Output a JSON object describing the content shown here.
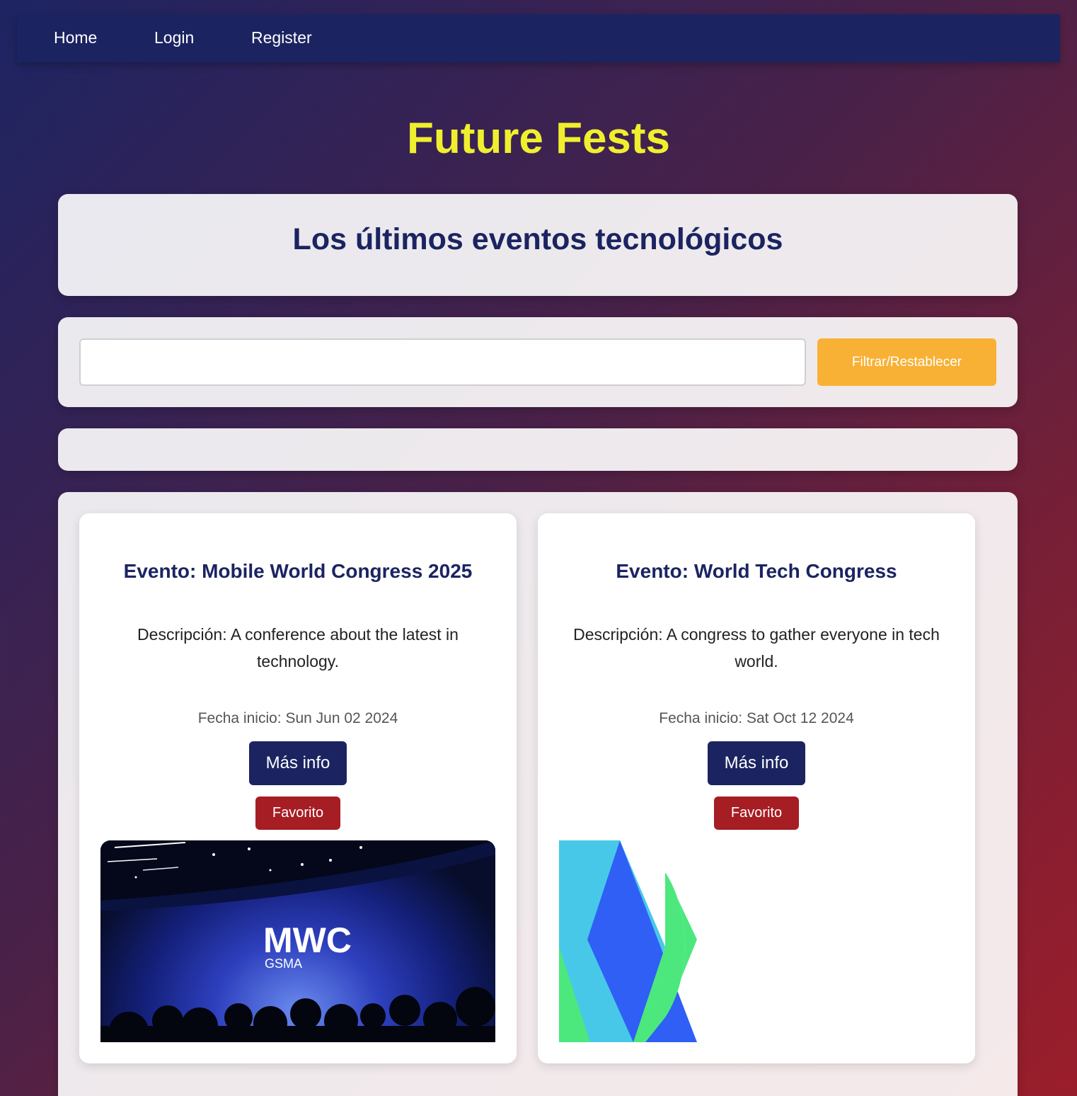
{
  "nav": {
    "home": "Home",
    "login": "Login",
    "register": "Register"
  },
  "site": {
    "title": "Future Fests"
  },
  "hero": {
    "heading": "Los últimos eventos tecnológicos"
  },
  "filter": {
    "input_value": "",
    "button_label": "Filtrar/Restablecer"
  },
  "events": [
    {
      "title": "Evento: Mobile World Congress 2025",
      "description": "Descripción: A conference about the latest in technology.",
      "date": "Fecha inicio: Sun Jun 02 2024",
      "info_label": "Más info",
      "favorite_label": "Favorito",
      "image_logo_text": "MWC",
      "image_logo_subtext": "GSMA"
    },
    {
      "title": "Evento: World Tech Congress",
      "description": "Descripción: A congress to gather everyone in tech world.",
      "date": "Fecha inicio: Sat Oct 12 2024",
      "info_label": "Más info",
      "favorite_label": "Favorito"
    }
  ],
  "colors": {
    "nav_bg": "#1b2461",
    "title": "#f0ef2e",
    "heading": "#1b2461",
    "filter_button": "#f8b135",
    "info_button": "#1b2461",
    "favorite_button": "#a61d24",
    "logo_green": "#4ce87e",
    "logo_cyan": "#48c8e8",
    "logo_blue": "#2f5ff5"
  }
}
